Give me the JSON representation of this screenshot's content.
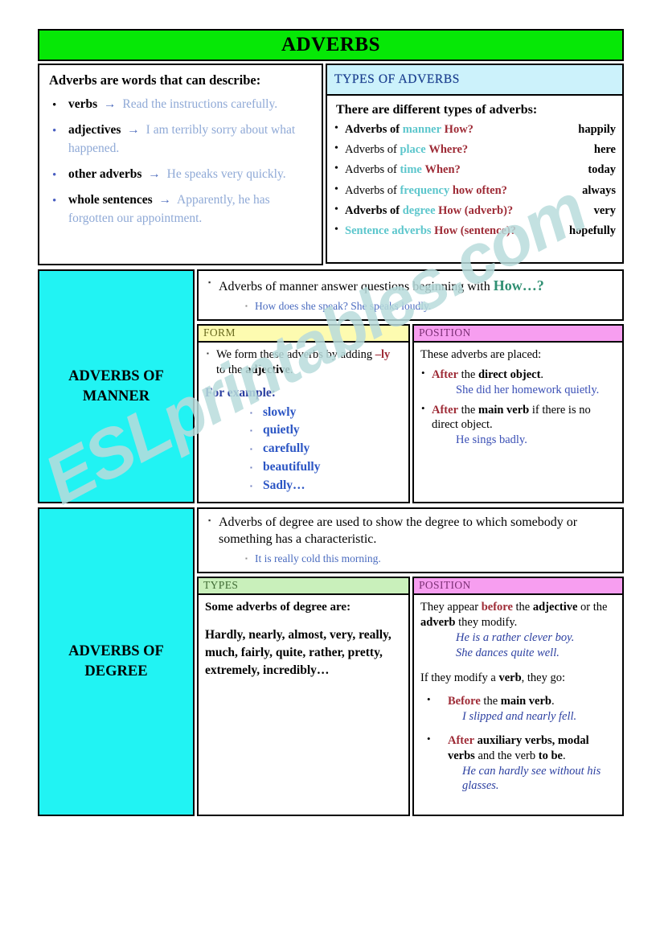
{
  "watermark": "ESLprintables.com",
  "title": "ADVERBS",
  "colors": {
    "title_bar": "#06e806",
    "types_header": "#ccf2fb",
    "side_cell": "#21f3f3",
    "form_header": "#fdfbb0",
    "position_header": "#f79ef0",
    "types_col_header": "#c9f0bb",
    "category_word": "#5cc6cc",
    "question_word": "#9e2b36",
    "example_blue": "#8fa9d6"
  },
  "describe_panel": {
    "heading": "Adverbs are words that can describe:",
    "items": [
      {
        "bullet": "•",
        "bullet_color": "dark",
        "keyword": "verbs",
        "arrow": "→",
        "example": "Read the instructions carefully."
      },
      {
        "bullet": "•",
        "bullet_color": "blue",
        "keyword": "adjectives",
        "arrow": "→",
        "example": "I am terribly sorry about what happened."
      },
      {
        "bullet": "•",
        "bullet_color": "blue",
        "keyword": "other adverbs",
        "arrow": "→",
        "example": "He speaks very quickly."
      },
      {
        "bullet": "•",
        "bullet_color": "blue",
        "keyword": "whole sentences",
        "arrow": "→",
        "example": "Apparently, he has forgotten our appointment."
      }
    ]
  },
  "types_panel": {
    "header": "TYPES OF ADVERBS",
    "lead": "There are different types of adverbs:",
    "rows": [
      {
        "prefix": "Adverbs of",
        "prefix_bold": true,
        "category": "manner",
        "question": "How?",
        "sample": "happily"
      },
      {
        "prefix": "Adverbs of",
        "prefix_bold": false,
        "category": "place",
        "question": "Where?",
        "sample": "here"
      },
      {
        "prefix": "Adverbs of",
        "prefix_bold": false,
        "category": "time",
        "question": "When?",
        "sample": "today"
      },
      {
        "prefix": "Adverbs of",
        "prefix_bold": false,
        "category": "frequency",
        "question": "how often?",
        "sample": "always"
      },
      {
        "prefix": "Adverbs of",
        "prefix_bold": true,
        "category": "degree",
        "question": "How (adverb)?",
        "sample": "very"
      },
      {
        "prefix": "",
        "prefix_bold": false,
        "category": "Sentence adverbs",
        "question": "How (sentence)?",
        "sample": "hopefully"
      }
    ]
  },
  "manner": {
    "side_label_line1": "ADVERBS OF",
    "side_label_line2": "MANNER",
    "intro_main_a": "Adverbs of manner answer questions beginning with ",
    "intro_main_b": "How…?",
    "intro_example": "How does she speak? She speaks loudly.",
    "form": {
      "header": "FORM",
      "rule_a": "We form these adverbs by adding ",
      "rule_b": "–ly",
      "rule_c": " to the ",
      "rule_d": "adjective",
      "rule_e": ".",
      "for_example": "For example:",
      "examples": [
        "slowly",
        "quietly",
        "carefully",
        "beautifully",
        "Sadly…"
      ]
    },
    "position": {
      "header": "POSITION",
      "lead": "These adverbs are placed:",
      "items": [
        {
          "kw": "After",
          "rest_a": " the ",
          "bold": "direct object",
          "rest_b": ".",
          "example": "She did her homework quietly."
        },
        {
          "kw": "After",
          "rest_a": " the ",
          "bold": "main verb",
          "rest_b": " if there is no direct object.",
          "example": "He sings badly."
        }
      ]
    }
  },
  "degree": {
    "side_label_line1": "ADVERBS OF",
    "side_label_line2": "DEGREE",
    "intro_main": "Adverbs of degree are used to show the degree to which somebody or something has a characteristic.",
    "intro_example": "It is really cold this morning.",
    "types": {
      "header": "TYPES",
      "lead": "Some adverbs of degree are:",
      "words": "Hardly, nearly, almost, very, really, much, fairly, quite, rather, pretty, extremely, incredibly…"
    },
    "position": {
      "header": "POSITION",
      "p1_a": "They appear ",
      "p1_kw": "before",
      "p1_b": " the ",
      "p1_bold1": "adjective",
      "p1_c": " or the ",
      "p1_bold2": "adverb",
      "p1_d": " they modify.",
      "p1_ex1": "He is a rather clever boy.",
      "p1_ex2": "She dances quite well.",
      "p2_a": "If they modify a ",
      "p2_bold": "verb",
      "p2_b": ", they go:",
      "items": [
        {
          "kw": "Before",
          "rest_a": " the ",
          "bold": "main verb",
          "rest_b": ".",
          "example": "I slipped and nearly fell."
        },
        {
          "kw": "After",
          "rest_a": " ",
          "bold": "auxiliary verbs, modal verbs",
          "rest_b": " and the verb ",
          "bold2": "to be",
          "rest_c": ".",
          "example": "He can hardly see without his glasses."
        }
      ]
    }
  }
}
